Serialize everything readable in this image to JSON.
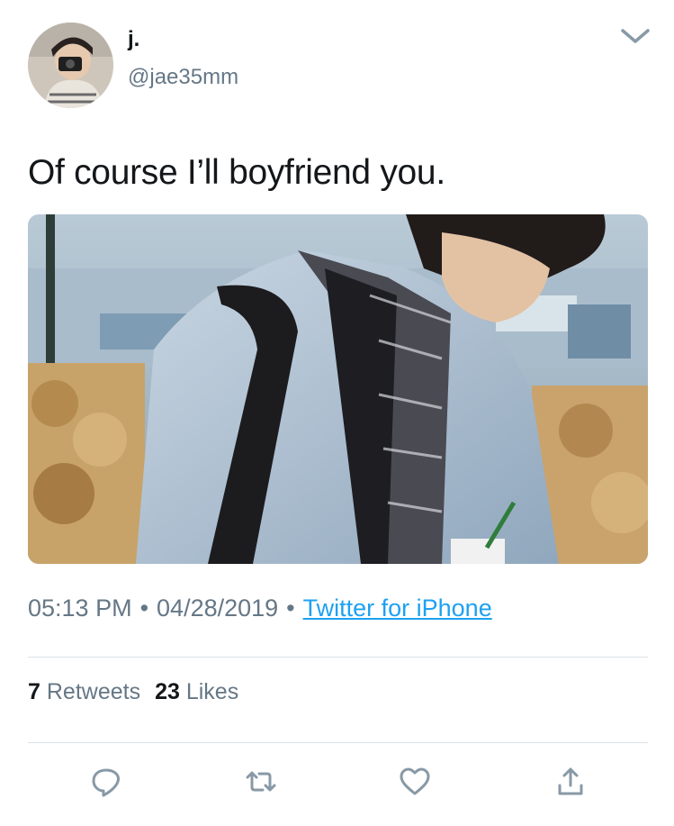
{
  "user": {
    "display_name": "j.",
    "handle": "@jae35mm"
  },
  "tweet": {
    "text": "Of course I’ll boyfriend you.",
    "time": "05:13 PM",
    "date": "04/28/2019",
    "separator": "•",
    "source": "Twitter for iPhone"
  },
  "stats": {
    "retweets_count": "7",
    "retweets_label": "Retweets",
    "likes_count": "23",
    "likes_label": "Likes"
  },
  "actions": {
    "reply_icon": "reply-icon",
    "retweet_icon": "retweet-icon",
    "like_icon": "heart-icon",
    "share_icon": "share-icon"
  },
  "colors": {
    "link": "#1da1f2",
    "secondary_text": "#657786",
    "primary_text": "#14171a",
    "divider": "#dbe2e8"
  }
}
